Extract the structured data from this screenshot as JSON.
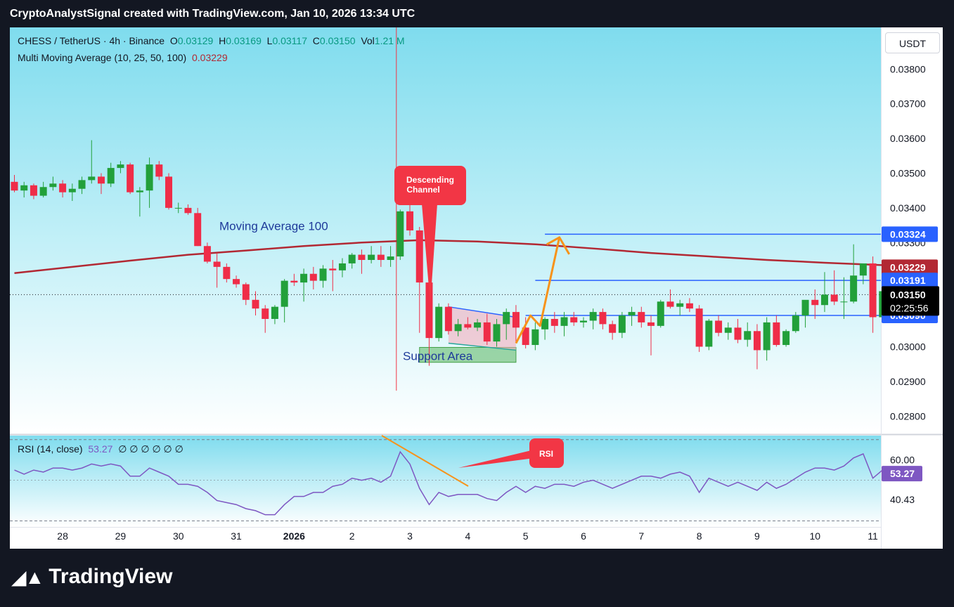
{
  "header": {
    "text": "CryptoAnalystSignal created with TradingView.com, Jan 10, 2026 13:34 UTC"
  },
  "legend": {
    "symbol": "CHESS / TetherUS · 4h · Binance",
    "o_label": "O",
    "o_value": "0.03129",
    "h_label": "H",
    "h_value": "0.03169",
    "l_label": "L",
    "l_value": "0.03117",
    "c_label": "C",
    "c_value": "0.03150",
    "vol_label": "Vol",
    "vol_value": "1.21 M",
    "ma_label": "Multi Moving Average (10, 25, 50, 100)",
    "ma_value": "0.03229",
    "rsi_label": "RSI (14, close)",
    "rsi_value": "53.27",
    "rsi_extra": "∅ ∅ ∅ ∅ ∅ ∅"
  },
  "currency_button": "USDT",
  "colors": {
    "up": "#22a03a",
    "down": "#ef2d48",
    "ma": "#b22833",
    "level": "#2962ff",
    "rsi": "#7e57c2",
    "annotation": "#f7931a",
    "callout": "#f23645"
  },
  "chart_data": {
    "type": "candlestick",
    "symbol": "CHESS / TetherUS",
    "timeframe": "4h",
    "exchange": "Binance",
    "ylim": [
      0.0275,
      0.0392
    ],
    "y_ticks": [
      "0.03800",
      "0.03700",
      "0.03600",
      "0.03500",
      "0.03400",
      "0.03300",
      "0.03200",
      "0.03100",
      "0.03000",
      "0.02900",
      "0.02800"
    ],
    "y_tick_values": [
      0.038,
      0.037,
      0.036,
      0.035,
      0.034,
      0.033,
      0.032,
      0.031,
      0.03,
      0.029,
      0.028
    ],
    "x_ticks": [
      "28",
      "29",
      "30",
      "31",
      "2026",
      "2",
      "3",
      "4",
      "5",
      "6",
      "7",
      "8",
      "9",
      "10",
      "11"
    ],
    "x_tick_bars": [
      5,
      11,
      17,
      23,
      29,
      35,
      41,
      47,
      53,
      59,
      65,
      71,
      77,
      83,
      89
    ],
    "candles": [
      [
        0.03475,
        0.03495,
        0.03445,
        0.0345
      ],
      [
        0.0345,
        0.03475,
        0.0343,
        0.03465
      ],
      [
        0.03465,
        0.0347,
        0.03425,
        0.03435
      ],
      [
        0.03435,
        0.03475,
        0.0343,
        0.0346
      ],
      [
        0.0346,
        0.0349,
        0.0345,
        0.0347
      ],
      [
        0.0347,
        0.0348,
        0.0343,
        0.03445
      ],
      [
        0.03445,
        0.0347,
        0.0342,
        0.03455
      ],
      [
        0.03455,
        0.0349,
        0.0344,
        0.0348
      ],
      [
        0.0348,
        0.03595,
        0.0347,
        0.0349
      ],
      [
        0.0349,
        0.035,
        0.0344,
        0.0347
      ],
      [
        0.0347,
        0.0353,
        0.0346,
        0.03515
      ],
      [
        0.03515,
        0.03535,
        0.035,
        0.03525
      ],
      [
        0.03525,
        0.0353,
        0.0344,
        0.03445
      ],
      [
        0.03445,
        0.0346,
        0.03375,
        0.0345
      ],
      [
        0.0345,
        0.03545,
        0.034,
        0.03525
      ],
      [
        0.03525,
        0.03535,
        0.0348,
        0.0349
      ],
      [
        0.0349,
        0.035,
        0.03395,
        0.034
      ],
      [
        0.034,
        0.03415,
        0.03385,
        0.034
      ],
      [
        0.034,
        0.0341,
        0.0338,
        0.03385
      ],
      [
        0.03385,
        0.034,
        0.0329,
        0.0329
      ],
      [
        0.0329,
        0.033,
        0.0324,
        0.03245
      ],
      [
        0.03245,
        0.0327,
        0.0317,
        0.0323
      ],
      [
        0.0323,
        0.0324,
        0.03185,
        0.03195
      ],
      [
        0.03195,
        0.03205,
        0.0317,
        0.0318
      ],
      [
        0.0318,
        0.03185,
        0.0312,
        0.03135
      ],
      [
        0.03135,
        0.0316,
        0.0309,
        0.0311
      ],
      [
        0.0311,
        0.0312,
        0.0304,
        0.0308
      ],
      [
        0.0308,
        0.0312,
        0.03065,
        0.03115
      ],
      [
        0.03115,
        0.03195,
        0.0307,
        0.0319
      ],
      [
        0.0319,
        0.0321,
        0.03175,
        0.03185
      ],
      [
        0.03185,
        0.03225,
        0.0313,
        0.0321
      ],
      [
        0.0321,
        0.0323,
        0.03165,
        0.0319
      ],
      [
        0.0319,
        0.03235,
        0.0317,
        0.03225
      ],
      [
        0.03225,
        0.0325,
        0.0316,
        0.0322
      ],
      [
        0.0322,
        0.03255,
        0.032,
        0.0324
      ],
      [
        0.0324,
        0.0327,
        0.03225,
        0.03265
      ],
      [
        0.03265,
        0.0328,
        0.0321,
        0.0325
      ],
      [
        0.0325,
        0.0329,
        0.0324,
        0.03265
      ],
      [
        0.03265,
        0.0329,
        0.0323,
        0.0325
      ],
      [
        0.0325,
        0.0329,
        0.0323,
        0.0326
      ],
      [
        0.0326,
        0.03395,
        0.0325,
        0.0339
      ],
      [
        0.0339,
        0.03415,
        0.0332,
        0.03335
      ],
      [
        0.03335,
        0.03345,
        0.0304,
        0.03185
      ],
      [
        0.03185,
        0.03225,
        0.02945,
        0.03025
      ],
      [
        0.03025,
        0.03125,
        0.03015,
        0.03115
      ],
      [
        0.03115,
        0.03125,
        0.03035,
        0.03045
      ],
      [
        0.03045,
        0.0308,
        0.0303,
        0.03065
      ],
      [
        0.03065,
        0.03085,
        0.0305,
        0.03055
      ],
      [
        0.03055,
        0.0308,
        0.03045,
        0.0307
      ],
      [
        0.0307,
        0.03095,
        0.03005,
        0.03015
      ],
      [
        0.03015,
        0.0308,
        0.03,
        0.03065
      ],
      [
        0.03065,
        0.0311,
        0.0302,
        0.031
      ],
      [
        0.031,
        0.0312,
        0.03015,
        0.03055
      ],
      [
        0.03055,
        0.03085,
        0.02995,
        0.03005
      ],
      [
        0.03005,
        0.0307,
        0.0299,
        0.0305
      ],
      [
        0.0305,
        0.03085,
        0.0302,
        0.0308
      ],
      [
        0.0308,
        0.031,
        0.0304,
        0.0306
      ],
      [
        0.0306,
        0.031,
        0.0303,
        0.03085
      ],
      [
        0.03085,
        0.031,
        0.0306,
        0.0307
      ],
      [
        0.0307,
        0.03085,
        0.03055,
        0.03075
      ],
      [
        0.03075,
        0.0311,
        0.0305,
        0.031
      ],
      [
        0.031,
        0.0311,
        0.0305,
        0.03065
      ],
      [
        0.03065,
        0.03075,
        0.0302,
        0.0304
      ],
      [
        0.0304,
        0.031,
        0.03025,
        0.0309
      ],
      [
        0.0309,
        0.03115,
        0.0306,
        0.031
      ],
      [
        0.031,
        0.03115,
        0.03055,
        0.0307
      ],
      [
        0.0307,
        0.0309,
        0.02975,
        0.0306
      ],
      [
        0.0306,
        0.03135,
        0.03055,
        0.0313
      ],
      [
        0.0313,
        0.03165,
        0.0311,
        0.03115
      ],
      [
        0.03115,
        0.03135,
        0.0309,
        0.03125
      ],
      [
        0.03125,
        0.0314,
        0.031,
        0.0311
      ],
      [
        0.0311,
        0.0312,
        0.02985,
        0.03
      ],
      [
        0.03,
        0.0308,
        0.0299,
        0.03075
      ],
      [
        0.03075,
        0.0309,
        0.0303,
        0.0304
      ],
      [
        0.0304,
        0.0307,
        0.0302,
        0.03055
      ],
      [
        0.03055,
        0.0308,
        0.0301,
        0.0302
      ],
      [
        0.0302,
        0.0307,
        0.03,
        0.03045
      ],
      [
        0.03045,
        0.03065,
        0.02935,
        0.0299
      ],
      [
        0.0299,
        0.03085,
        0.0296,
        0.0307
      ],
      [
        0.0307,
        0.0309,
        0.03,
        0.03005
      ],
      [
        0.03005,
        0.0305,
        0.03,
        0.03045
      ],
      [
        0.03045,
        0.031,
        0.0304,
        0.0309
      ],
      [
        0.0309,
        0.03125,
        0.03055,
        0.03135
      ],
      [
        0.03135,
        0.03165,
        0.0308,
        0.0312
      ],
      [
        0.0312,
        0.03215,
        0.031,
        0.0315
      ],
      [
        0.0315,
        0.0322,
        0.0312,
        0.0313
      ],
      [
        0.0313,
        0.032,
        0.0308,
        0.0313
      ],
      [
        0.0313,
        0.03295,
        0.03125,
        0.03205
      ],
      [
        0.03205,
        0.0324,
        0.0318,
        0.0324
      ],
      [
        0.0324,
        0.0326,
        0.0304,
        0.03085
      ],
      [
        0.03085,
        0.0317,
        0.0307,
        0.0316
      ],
      [
        0.0316,
        0.0317,
        0.0311,
        0.0313
      ],
      [
        0.03129,
        0.03169,
        0.03117,
        0.0315
      ]
    ],
    "ma100": [
      [
        0,
        0.03212
      ],
      [
        6,
        0.0323
      ],
      [
        12,
        0.03248
      ],
      [
        18,
        0.03265
      ],
      [
        24,
        0.03277
      ],
      [
        30,
        0.0329
      ],
      [
        36,
        0.033
      ],
      [
        42,
        0.03307
      ],
      [
        48,
        0.03303
      ],
      [
        54,
        0.03295
      ],
      [
        60,
        0.03283
      ],
      [
        66,
        0.0327
      ],
      [
        72,
        0.0326
      ],
      [
        78,
        0.0325
      ],
      [
        84,
        0.03242
      ],
      [
        90,
        0.03235
      ],
      [
        94,
        0.03229
      ]
    ],
    "levels": [
      {
        "value": 0.03324,
        "label": "0.03324",
        "start_bar": 55
      },
      {
        "value": 0.03191,
        "label": "0.03191",
        "start_bar": 54
      },
      {
        "value": 0.0309,
        "label": "0.03090",
        "start_bar": 53
      }
    ],
    "current_price": {
      "value": 0.0315,
      "label": "0.03150",
      "countdown": "02:25:56"
    },
    "ma_price_label": "0.03229",
    "annotations": {
      "ma_text": "Moving Average 100",
      "support_text": "Support Area",
      "channel_text_1": "Descending",
      "channel_text_2": "Channel",
      "rsi_callout": "RSI",
      "support_zone": {
        "start_bar": 42,
        "end_bar": 52,
        "low": 0.02955,
        "high": 0.02998
      },
      "channel": {
        "upper": [
          [
            45,
            0.03115
          ],
          [
            52,
            0.03085
          ]
        ],
        "lower": [
          [
            45,
            0.0301
          ],
          [
            52,
            0.0299
          ]
        ]
      },
      "arrow_path": [
        [
          52,
          0.0301
        ],
        [
          53.5,
          0.0309
        ],
        [
          54.5,
          0.0306
        ],
        [
          56.5,
          0.03315
        ]
      ]
    },
    "rsi": {
      "ylim": [
        27,
        72
      ],
      "overbought": 70,
      "oversold": 30,
      "ticks": [
        "60.00",
        "53.01",
        "40.43"
      ],
      "tick_values": [
        60.0,
        53.01,
        40.43
      ],
      "current_label": "53.27",
      "current_value": 53.27,
      "values": [
        55,
        53,
        55,
        54,
        56,
        56,
        55,
        56,
        58,
        57,
        58,
        57,
        52,
        52,
        56,
        54,
        52,
        48,
        48,
        47,
        44,
        40,
        39,
        38,
        36,
        35,
        33,
        33,
        38,
        42,
        42,
        44,
        44,
        47,
        48,
        51,
        50,
        51,
        49,
        52,
        64,
        58,
        46,
        38,
        44,
        42,
        43,
        43,
        43,
        41,
        40,
        44,
        47,
        44,
        47,
        46,
        48,
        48,
        47,
        49,
        50,
        48,
        46,
        48,
        50,
        52,
        52,
        51,
        53,
        54,
        52,
        44,
        51,
        49,
        47,
        49,
        47,
        45,
        49,
        46,
        48,
        51,
        54,
        56,
        56,
        55,
        57,
        61,
        63,
        51,
        55,
        52,
        53.27
      ]
    }
  }
}
